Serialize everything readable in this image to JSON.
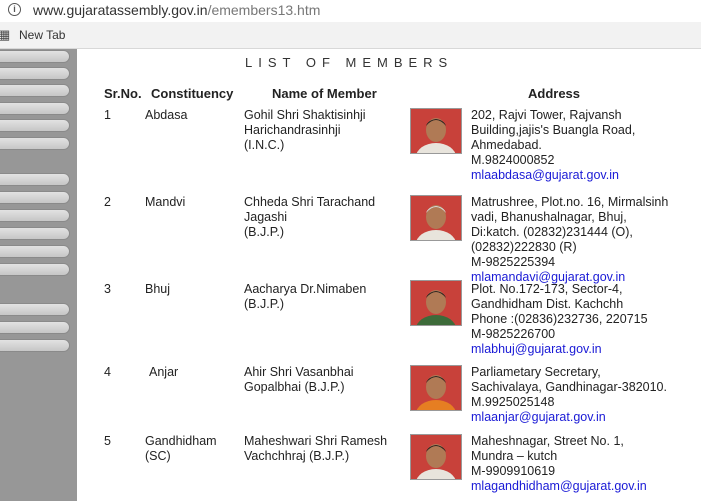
{
  "browser": {
    "url_domain": "www.gujaratassembly.gov.in",
    "url_path": "/emembers13.htm",
    "bookmark_new_tab": "New Tab"
  },
  "page": {
    "title": "LIST OF MEMBERS",
    "headers": {
      "srno": "Sr.No.",
      "constituency": "Constituency",
      "name": "Name of Member",
      "address": "Address"
    }
  },
  "members": [
    {
      "srno": "1",
      "constituency": [
        "Abdasa"
      ],
      "name": [
        "Gohil Shri Shaktisinhji",
        "Harichandrasinhji",
        "(I.N.C.)"
      ],
      "address": [
        "202, Rajvi Tower, Rajvansh",
        "Building,jajis's Buangla Road,",
        "Ahmedabad.",
        "M.9824000852"
      ],
      "email": "mlaabdasa@gujarat.gov.in"
    },
    {
      "srno": "2",
      "constituency": [
        "Mandvi"
      ],
      "name": [
        "Chheda Shri Tarachand",
        "Jagashi",
        "(B.J.P.)"
      ],
      "address": [
        "Matrushree, Plot.no. 16, Mirmalsinh",
        "vadi, Bhanushalnagar, Bhuj,",
        "Di:katch. (02832)231444 (O),",
        "(02832)222830 (R)",
        "M-9825225394"
      ],
      "email": "mlamandavi@gujarat.gov.in"
    },
    {
      "srno": "3",
      "constituency": [
        "Bhuj"
      ],
      "name": [
        "Aacharya Dr.Nimaben",
        "(B.J.P.)"
      ],
      "address": [
        "Plot. No.172-173, Sector-4,",
        "Gandhidham Dist. Kachchh",
        "Phone :(02836)232736, 220715",
        "M-9825226700"
      ],
      "email": "mlabhuj@gujarat.gov.in"
    },
    {
      "srno": "4",
      "constituency": [
        "Anjar"
      ],
      "name": [
        "Ahir Shri Vasanbhai",
        "Gopalbhai (B.J.P.)"
      ],
      "address": [
        "Parliametary Secretary,",
        " Sachivalaya, Gandhinagar-382010.",
        "M.9925025148"
      ],
      "email": "mlaanjar@gujarat.gov.in"
    },
    {
      "srno": "5",
      "constituency": [
        "Gandhidham",
        "(SC)"
      ],
      "name": [
        "Maheshwari Shri Ramesh",
        "Vachchhraj (B.J.P.)"
      ],
      "address": [
        "Maheshnagar, Street No. 1,",
        "Mundra – kutch",
        "M-9909910619"
      ],
      "email": "mlagandhidham@gujarat.gov.in"
    }
  ],
  "colors": {
    "link": "#1a1ad6",
    "sidebar": "#979797",
    "photo_bg": "#c8413a"
  }
}
